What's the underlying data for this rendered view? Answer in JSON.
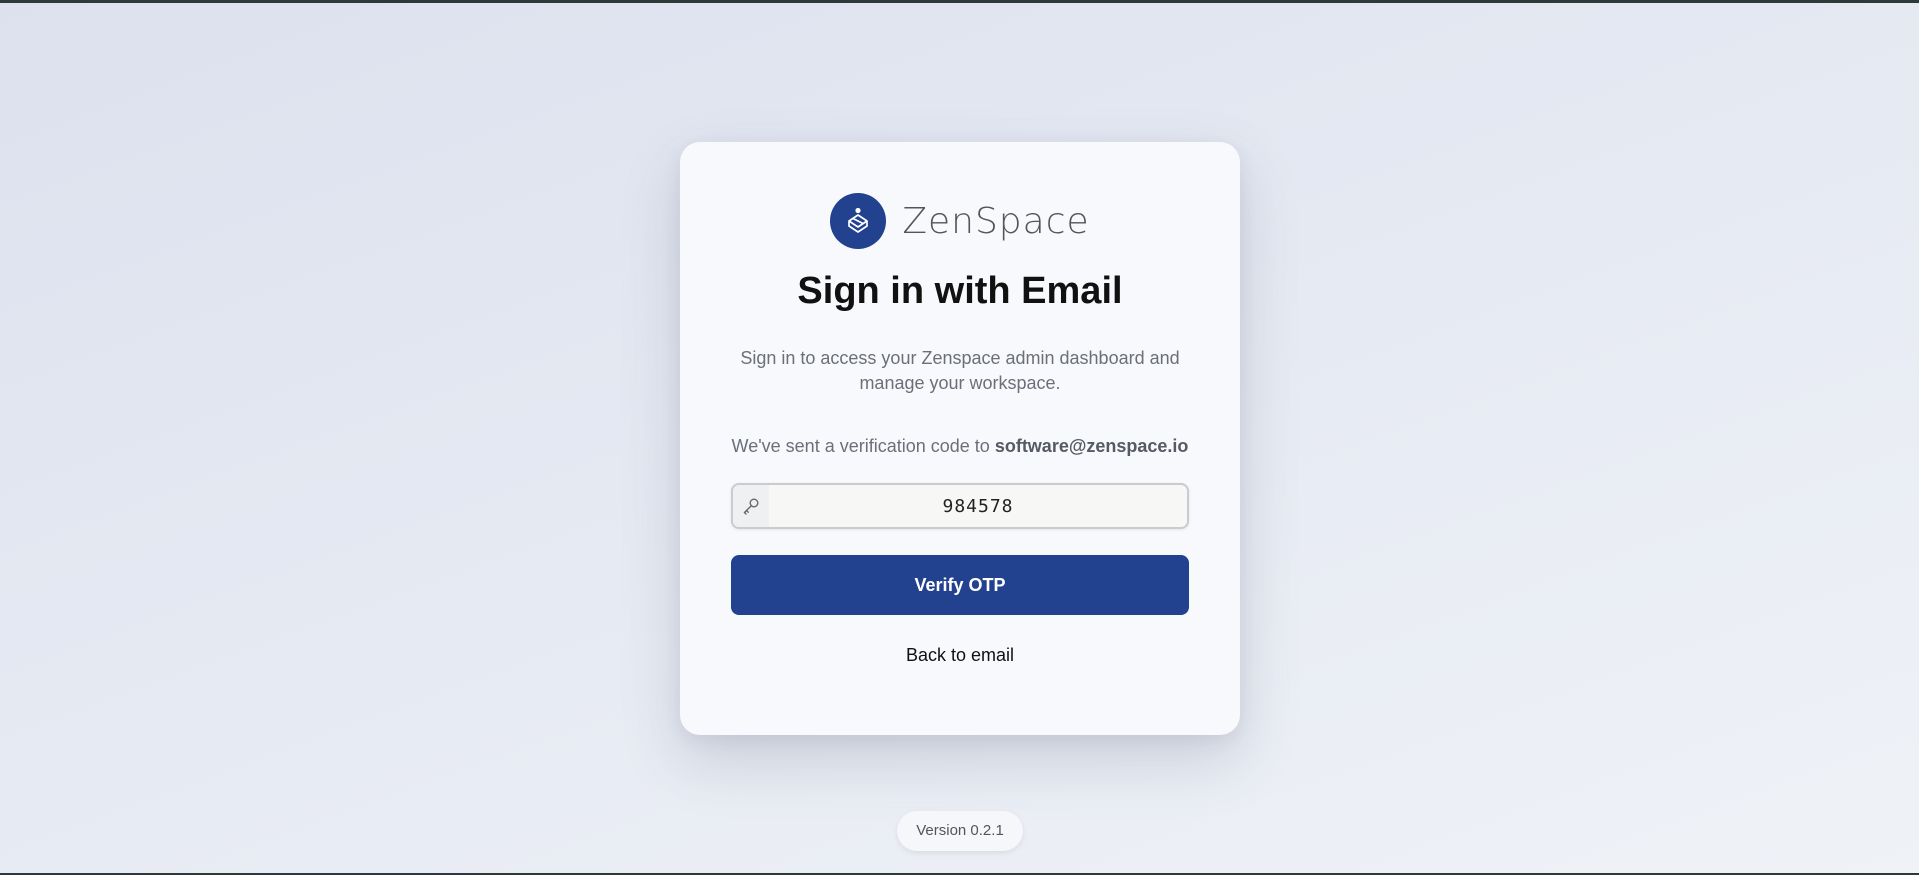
{
  "brand": {
    "name": "ZenSpace",
    "logo_color": "#22418f"
  },
  "signin": {
    "title": "Sign in with Email",
    "subtitle": "Sign in to access your Zenspace admin dashboard and manage your workspace.",
    "sent_prefix": "We've sent a verification code to",
    "email": "software@zenspace.io"
  },
  "otp": {
    "icon": "key-icon",
    "value": "984578"
  },
  "actions": {
    "verify_label": "Verify OTP",
    "back_label": "Back to email"
  },
  "footer": {
    "version": "Version 0.2.1"
  },
  "colors": {
    "primary": "#22418f",
    "background": "#e5e9f2"
  }
}
